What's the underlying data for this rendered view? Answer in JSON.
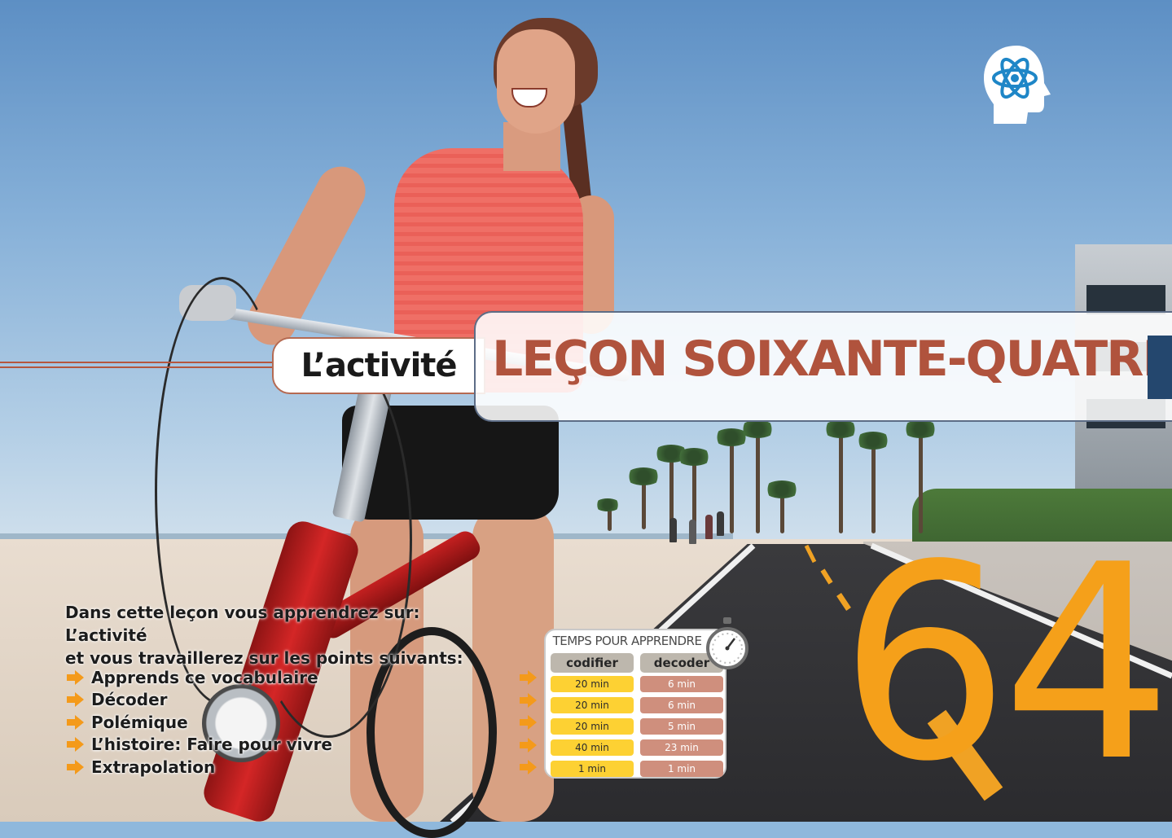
{
  "colors": {
    "accent_orange": "#f5a01a",
    "title_rust": "#b0533d",
    "title_bar_navy": "#24476e",
    "logo_blue": "#1e86c7",
    "codifier_yellow": "#fdd133",
    "decoder_rust": "#cf8f7d"
  },
  "logo": {
    "icon": "atom-head-icon"
  },
  "header": {
    "category": "L’activité",
    "title": "LEÇON SOIXANTE-QUATRE"
  },
  "lesson_number": "64",
  "intro": {
    "line1": "Dans cette leçon vous apprendrez sur: L’activité",
    "line2": "et vous travaillerez sur les points suivants:"
  },
  "points": [
    "Apprends ce vocabulaire",
    "Décoder",
    "Polémique",
    "L’histoire: Faire pour vivre",
    "Extrapolation"
  ],
  "time_table": {
    "title": "TEMPS POUR APPRENDRE",
    "icon": "stopwatch-icon",
    "headers": [
      "codifier",
      "decoder"
    ],
    "rows": [
      [
        "20 min",
        "6 min"
      ],
      [
        "20 min",
        "6 min"
      ],
      [
        "20 min",
        "5 min"
      ],
      [
        "40 min",
        "23 min"
      ],
      [
        "1 min",
        "1 min"
      ]
    ]
  }
}
